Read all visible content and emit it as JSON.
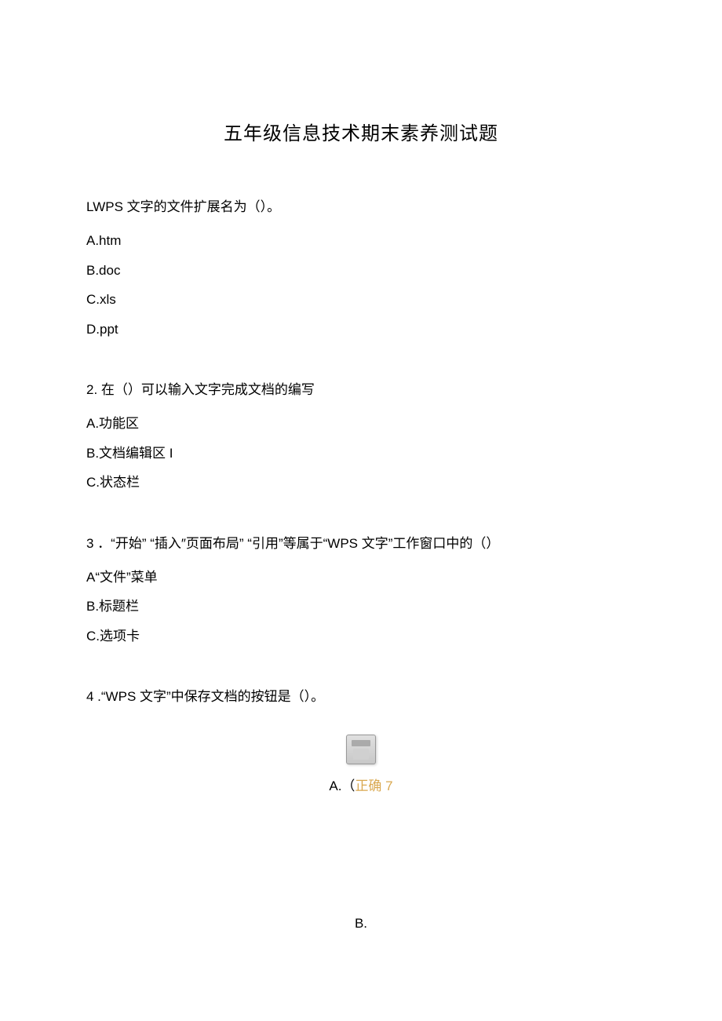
{
  "title": "五年级信息技术期末素养测试题",
  "q1": {
    "text": "LWPS 文字的文件扩展名为（）。",
    "options": {
      "a": "A.htm",
      "b": "B.doc",
      "c": "C.xls",
      "d": "D.ppt"
    }
  },
  "q2": {
    "text": "2. 在（）可以输入文字完成文档的编写",
    "options": {
      "a": "A.功能区",
      "b": "B.文档编辑区 I",
      "c": "C.状态栏"
    }
  },
  "q3": {
    "text": "3 ．“开始” “插入″页面布局” “引用”等属于“WPS 文字”工作窗口中的（）",
    "options": {
      "a": "A“文件”菜单",
      "b": "B.标题栏",
      "c": "C.选项卡"
    }
  },
  "q4": {
    "text": "4 .“WPS 文字”中保存文档的按钮是（）。",
    "answer_a_prefix": "A.（",
    "answer_a_correct": "正确 7",
    "answer_b": "B."
  }
}
